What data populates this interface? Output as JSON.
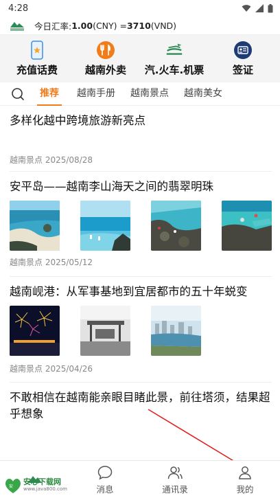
{
  "status_bar": {
    "time": "4:28"
  },
  "rate_bar": {
    "prefix": "今日汇率: ",
    "cny_value": "1.00",
    "cny_label": " (CNY) = ",
    "vnd_value": "3710",
    "vnd_label": " (VND)"
  },
  "services": [
    {
      "label": "充值话费",
      "icon": "phone-topup-icon"
    },
    {
      "label": "越南外卖",
      "icon": "food-delivery-icon"
    },
    {
      "label": "汽.火车.机票",
      "icon": "transport-icon"
    },
    {
      "label": "签证",
      "icon": "visa-icon"
    }
  ],
  "tabs": [
    "推荐",
    "越南手册",
    "越南景点",
    "越南美女"
  ],
  "active_tab": "推荐",
  "articles": [
    {
      "title": "多样化越中跨境旅游新亮点",
      "category": "越南景点",
      "date": "2025/08/28"
    },
    {
      "title": "安平岛——越南李山海天之间的翡翠明珠",
      "category": "越南景点",
      "date": "2025/05/12"
    },
    {
      "title": "越南岘港：从军事基地到宜居都市的五十年蜕变",
      "category": "越南景点",
      "date": "2025/04/26"
    },
    {
      "title": "不敢相信在越南能亲眼目睹此景，前往塔须，结果超乎想象",
      "category": "",
      "date": ""
    }
  ],
  "bottom_nav": [
    {
      "label": "",
      "icon": "home-icon"
    },
    {
      "label": "消息",
      "icon": "message-icon"
    },
    {
      "label": "通讯录",
      "icon": "contacts-icon"
    },
    {
      "label": "我的",
      "icon": "profile-icon"
    }
  ],
  "watermark": {
    "title": "安心下载网",
    "url": "www.java800.com"
  },
  "colors": {
    "accent": "#f07d1a",
    "service_green": "#2e8b57",
    "visa_navy": "#1f3b73",
    "arrow": "#e02020"
  }
}
